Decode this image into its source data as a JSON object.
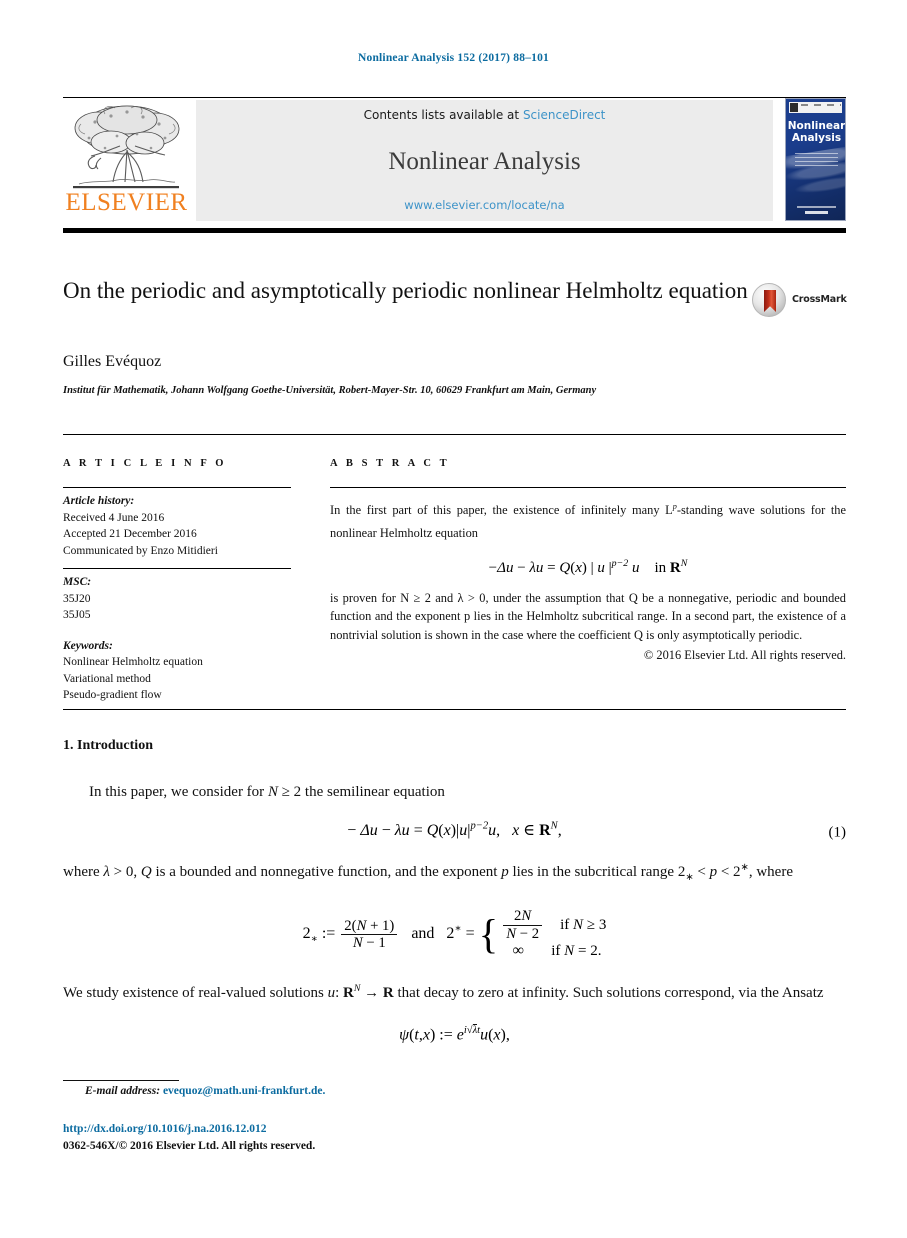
{
  "running_head": "Nonlinear Analysis 152 (2017) 88–101",
  "masthead": {
    "contents_prefix": "Contents lists available at ",
    "sciencedirect": "ScienceDirect",
    "journal_name": "Nonlinear Analysis",
    "journal_url": "www.elsevier.com/locate/na",
    "publisher": "ELSEVIER",
    "cover_title": "Nonlinear Analysis",
    "link_color": "#3d93c8",
    "publisher_color": "#f08020"
  },
  "article": {
    "title": "On the periodic and asymptotically periodic nonlinear Helmholtz equation",
    "author": "Gilles Evéquoz",
    "affiliation": "Institut für Mathematik, Johann Wolfgang Goethe-Universität, Robert-Mayer-Str. 10, 60629 Frankfurt am Main, Germany",
    "crossmark_label": "CrossMark"
  },
  "info": {
    "label": "A R T I C L E   I N F O",
    "history_heading": "Article history:",
    "received": "Received 4 June 2016",
    "accepted": "Accepted 21 December 2016",
    "communicated": "Communicated by Enzo Mitidieri",
    "msc_heading": "MSC:",
    "msc_codes": [
      "35J20",
      "35J05"
    ],
    "keywords_heading": "Keywords:",
    "keywords": [
      "Nonlinear Helmholtz equation",
      "Variational method",
      "Pseudo-gradient flow"
    ]
  },
  "abstract": {
    "label": "A B S T R A C T",
    "part1": "In the first part of this paper, the existence of infinitely many L",
    "part1_sup": "p",
    "part1_cont": "-standing wave solutions for the nonlinear Helmholtz equation",
    "equation": "−Δu − λu = Q(x) | u |^(p−2) u    in R^N",
    "part2": "is proven for N ≥ 2 and λ > 0, under the assumption that Q be a nonnegative, periodic and bounded function and the exponent p lies in the Helmholtz subcritical range. In a second part, the existence of a nontrivial solution is shown in the case where the coefficient Q is only asymptotically periodic.",
    "copyright": "© 2016 Elsevier Ltd. All rights reserved."
  },
  "body": {
    "section_heading": "1. Introduction",
    "para1": "In this paper, we consider for N ≥ 2 the semilinear equation",
    "eq1": "− Δu − λu = Q(x)|u|^(p−2)u,   x ∈ R^N,",
    "eq1_number": "(1)",
    "para2": "where λ > 0, Q is a bounded and nonnegative function, and the exponent p lies in the subcritical range 2* < p < 2*, where",
    "eq2_case1": "if N ≥ 3",
    "eq2_case2": "if N = 2.",
    "para3": "We study existence of real-valued solutions u: R^N → R that decay to zero at infinity. Such solutions correspond, via the Ansatz",
    "eq3": "ψ(t,x) := e^(i√λ t) u(x),"
  },
  "footer": {
    "email_label": "E-mail address:",
    "email": "evequoz@math.uni-frankfurt.de.",
    "doi": "http://dx.doi.org/10.1016/j.na.2016.12.012",
    "issn_line": "0362-546X/© 2016 Elsevier Ltd. All rights reserved.",
    "link_color": "#0b6ba0"
  }
}
